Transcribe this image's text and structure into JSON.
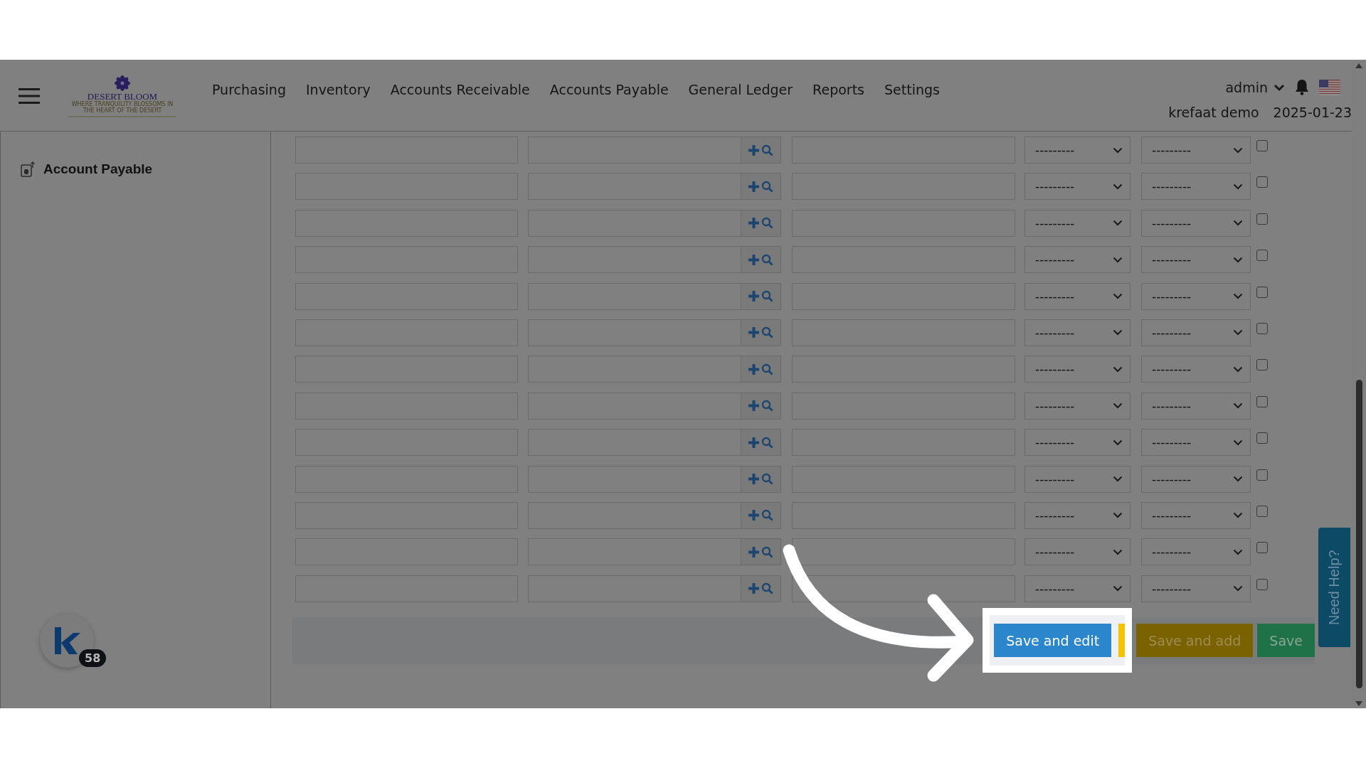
{
  "nav": {
    "logo": {
      "name": "DESERT BLOOM",
      "tagline": "WHERE TRANQUILITY BLOSSOMS IN THE HEART OF THE DESERT"
    },
    "menu": [
      "Purchasing",
      "Inventory",
      "Accounts Receivable",
      "Accounts Payable",
      "General Ledger",
      "Reports",
      "Settings"
    ],
    "user": "admin",
    "company": "krefaat demo",
    "date": "2025-01-23"
  },
  "sidebar": {
    "items": [
      {
        "label": "Account Payable"
      }
    ]
  },
  "form": {
    "rows": [
      {
        "select_1": "---------",
        "select_2": "---------",
        "checked": false
      },
      {
        "select_1": "---------",
        "select_2": "---------",
        "checked": false
      },
      {
        "select_1": "---------",
        "select_2": "---------",
        "checked": false
      },
      {
        "select_1": "---------",
        "select_2": "---------",
        "checked": false
      },
      {
        "select_1": "---------",
        "select_2": "---------",
        "checked": false
      },
      {
        "select_1": "---------",
        "select_2": "---------",
        "checked": false
      },
      {
        "select_1": "---------",
        "select_2": "---------",
        "checked": false
      },
      {
        "select_1": "---------",
        "select_2": "---------",
        "checked": false
      },
      {
        "select_1": "---------",
        "select_2": "---------",
        "checked": false
      },
      {
        "select_1": "---------",
        "select_2": "---------",
        "checked": false
      },
      {
        "select_1": "---------",
        "select_2": "---------",
        "checked": false
      },
      {
        "select_1": "---------",
        "select_2": "---------",
        "checked": false
      },
      {
        "select_1": "---------",
        "select_2": "---------",
        "checked": false
      }
    ]
  },
  "actions": [
    {
      "label": "Save and edit",
      "kind": "primary",
      "highlighted": true
    },
    {
      "label": "Save and add",
      "kind": "warning",
      "highlighted": false
    },
    {
      "label": "Save",
      "kind": "success",
      "highlighted": false
    }
  ],
  "help_tab": {
    "label": "Need Help?"
  },
  "widget": {
    "count": "58"
  }
}
